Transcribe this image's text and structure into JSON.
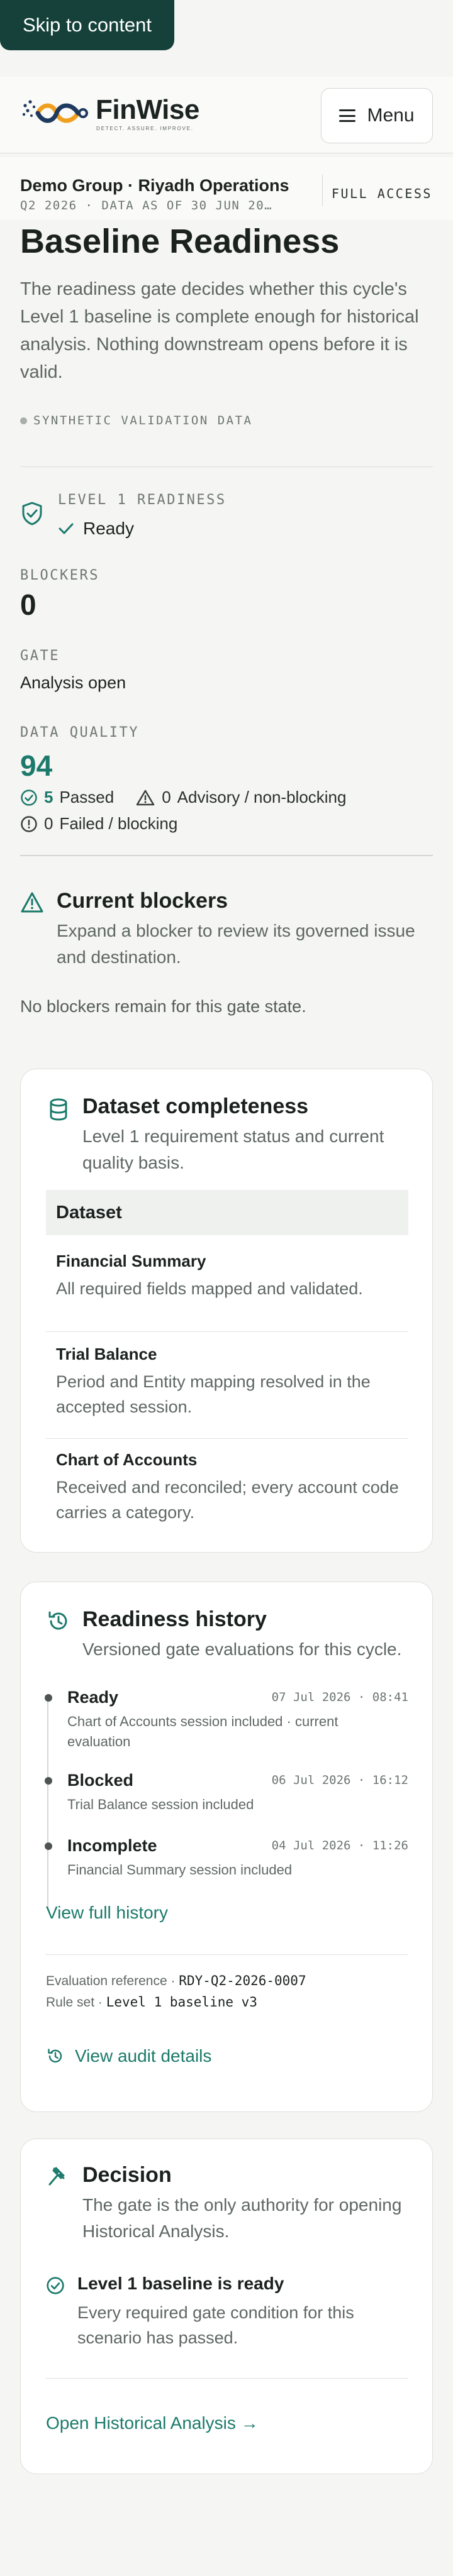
{
  "skip_link": "Skip to content",
  "header": {
    "brand": "FinWise",
    "tagline": "DETECT. ASSURE. IMPROVE.",
    "menu_label": "Menu"
  },
  "context": {
    "organisation": "Demo Group · Riyadh Operations",
    "period": "Q2 2026 · DATA AS OF 30 JUN 20…",
    "access": "FULL ACCESS"
  },
  "page": {
    "title": "Baseline Readiness",
    "lede": "The readiness gate decides whether this cycle's Level 1 baseline is complete enough for historical analysis. Nothing downstream opens before it is valid.",
    "synthetic_badge": "SYNTHETIC VALIDATION DATA"
  },
  "status": {
    "readiness_label": "LEVEL 1 READINESS",
    "readiness_value": "Ready",
    "blockers_label": "BLOCKERS",
    "blockers_value": "0",
    "gate_label": "GATE",
    "gate_value": "Analysis open",
    "quality_label": "DATA QUALITY",
    "quality_value": "94",
    "passed_count": "5",
    "passed_label": "Passed",
    "advisory_count": "0",
    "advisory_label": "Advisory / non-blocking",
    "failed_count": "0",
    "failed_label": "Failed / blocking"
  },
  "blockers": {
    "title": "Current blockers",
    "description": "Expand a blocker to review its governed issue and destination.",
    "empty": "No blockers remain for this gate state."
  },
  "completeness": {
    "title": "Dataset completeness",
    "description": "Level 1 requirement status and current quality basis.",
    "column_header": "Dataset",
    "datasets": [
      {
        "name": "Financial Summary",
        "note": "All required fields mapped and validated."
      },
      {
        "name": "Trial Balance",
        "note": "Period and Entity mapping resolved in the accepted session."
      },
      {
        "name": "Chart of Accounts",
        "note": "Received and reconciled; every account code carries a category."
      }
    ]
  },
  "history": {
    "title": "Readiness history",
    "description": "Versioned gate evaluations for this cycle.",
    "events": [
      {
        "state": "Ready",
        "time": "07 Jul 2026 · 08:41",
        "note": "Chart of Accounts session included · current evaluation"
      },
      {
        "state": "Blocked",
        "time": "06 Jul 2026 · 16:12",
        "note": "Trial Balance session included"
      },
      {
        "state": "Incomplete",
        "time": "04 Jul 2026 · 11:26",
        "note": "Financial Summary session included"
      }
    ],
    "full_history_link": "View full history",
    "evaluation_label": "Evaluation reference ·",
    "evaluation_ref": "RDY-Q2-2026-0007",
    "ruleset_label": "Rule set ·",
    "ruleset_value": "Level 1 baseline v3",
    "audit_link": "View audit details"
  },
  "decision": {
    "title": "Decision",
    "description": "The gate is the only authority for opening Historical Analysis.",
    "outcome_title": "Level 1 baseline is ready",
    "outcome_description": "Every required gate condition for this scenario has passed.",
    "cta": "Open Historical Analysis →"
  },
  "colors": {
    "brand_dark": "#15413a",
    "accent_green": "#1b7a6b",
    "logo_orange": "#f0a020",
    "logo_navy": "#1f3a5f"
  }
}
